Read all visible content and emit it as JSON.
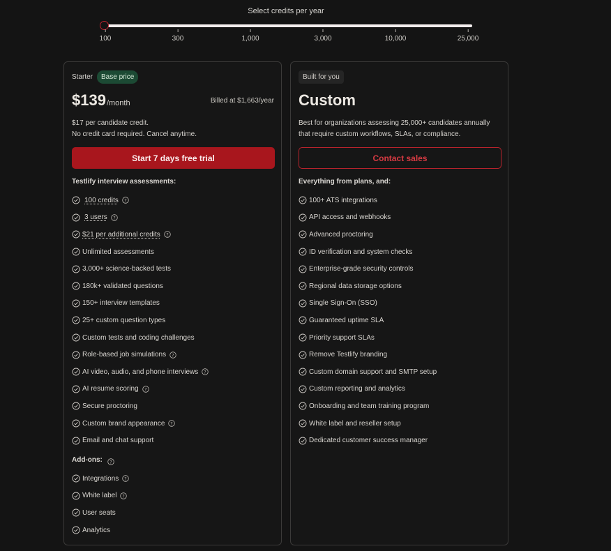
{
  "slider": {
    "title": "Select credits per year",
    "ticks": [
      "100",
      "300",
      "1,000",
      "3,000",
      "10,000",
      "25,000"
    ],
    "selected": "100"
  },
  "starter": {
    "plan_name": "Starter",
    "badge": "Base price",
    "price": "$139",
    "period": "/month",
    "billed": "Billed at $1,663/year",
    "desc_line1": "$17 per candidate credit.",
    "desc_line2": "No credit card required. Cancel anytime.",
    "cta": "Start 7 days free trial",
    "features_title": "Testlify interview assessments:",
    "features": [
      {
        "label": "100 credits",
        "help": true,
        "underline": true,
        "indent": true
      },
      {
        "label": "3 users",
        "help": true,
        "underline": true,
        "indent": true
      },
      {
        "label": "$21 per additional credits",
        "help": true,
        "underline": true,
        "indent": false
      },
      {
        "label": "Unlimited assessments",
        "help": false
      },
      {
        "label": "3,000+ science-backed tests",
        "help": false
      },
      {
        "label": "180k+ validated questions",
        "help": false
      },
      {
        "label": "150+ interview templates",
        "help": false
      },
      {
        "label": "25+ custom question types",
        "help": false
      },
      {
        "label": "Custom tests and coding challenges",
        "help": false
      },
      {
        "label": "Role-based job simulations",
        "help": true
      },
      {
        "label": "AI video, audio, and phone interviews",
        "help": true
      },
      {
        "label": "AI resume scoring",
        "help": true
      },
      {
        "label": "Secure proctoring",
        "help": false
      },
      {
        "label": "Custom brand appearance",
        "help": true
      },
      {
        "label": "Email and chat support",
        "help": false
      }
    ],
    "addons_title": "Add-ons:",
    "addons": [
      {
        "label": "Integrations",
        "help": true
      },
      {
        "label": "White label",
        "help": true
      },
      {
        "label": "User seats",
        "help": false
      },
      {
        "label": "Analytics",
        "help": false
      }
    ]
  },
  "custom": {
    "tag": "Built for you",
    "title": "Custom",
    "desc_line1": "Best for organizations assessing 25,000+ candidates annually",
    "desc_line2": "that require custom workflows, SLAs, or compliance.",
    "cta": "Contact sales",
    "features_title": "Everything from plans, and:",
    "features": [
      "100+ ATS integrations",
      "API access and webhooks",
      "Advanced proctoring",
      "ID verification and system checks",
      "Enterprise-grade security controls",
      "Regional data storage options",
      "Single Sign-On (SSO)",
      "Guaranteed uptime SLA",
      "Priority support SLAs",
      "Remove Testlify branding",
      "Custom domain support and SMTP setup",
      "Custom reporting and analytics",
      "Onboarding and team training program",
      "White label and reseller setup",
      "Dedicated customer success manager"
    ]
  },
  "colors": {
    "background": "#141414",
    "accent_red": "#a8161d",
    "badge_green": "#1c4a34"
  }
}
